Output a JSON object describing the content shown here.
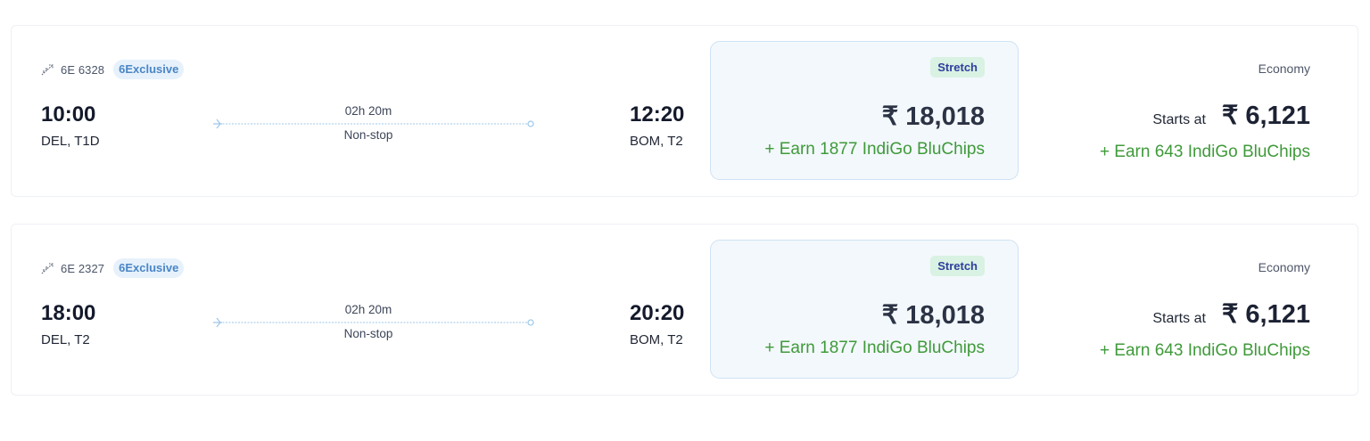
{
  "flights": [
    {
      "flight_number": "6E 6328",
      "badge": "6Exclusive",
      "departure_time": "10:00",
      "departure_airport": "DEL, T1D",
      "duration": "02h 20m",
      "stops": "Non-stop",
      "arrival_time": "12:20",
      "arrival_airport": "BOM, T2",
      "stretch": {
        "label": "Stretch",
        "price": "₹ 18,018",
        "earn": "+ Earn 1877 IndiGo BluChips"
      },
      "economy": {
        "label": "Economy",
        "starts_at": "Starts at",
        "price": "₹ 6,121",
        "earn": "+ Earn 643 IndiGo BluChips"
      }
    },
    {
      "flight_number": "6E 2327",
      "badge": "6Exclusive",
      "departure_time": "18:00",
      "departure_airport": "DEL, T2",
      "duration": "02h 20m",
      "stops": "Non-stop",
      "arrival_time": "20:20",
      "arrival_airport": "BOM, T2",
      "stretch": {
        "label": "Stretch",
        "price": "₹ 18,018",
        "earn": "+ Earn 1877 IndiGo BluChips"
      },
      "economy": {
        "label": "Economy",
        "starts_at": "Starts at",
        "price": "₹ 6,121",
        "earn": "+ Earn 643 IndiGo BluChips"
      }
    }
  ],
  "colors": {
    "earn_green": "#3f9a3a",
    "route_line": "#9cc7ea",
    "stretch_bg": "#f3f8fc",
    "badge_bg": "#e6f1fb"
  },
  "icons": {
    "flight": "plane-takeoff-icon",
    "route_start": "plane-icon",
    "route_end": "circle-dot-icon"
  }
}
